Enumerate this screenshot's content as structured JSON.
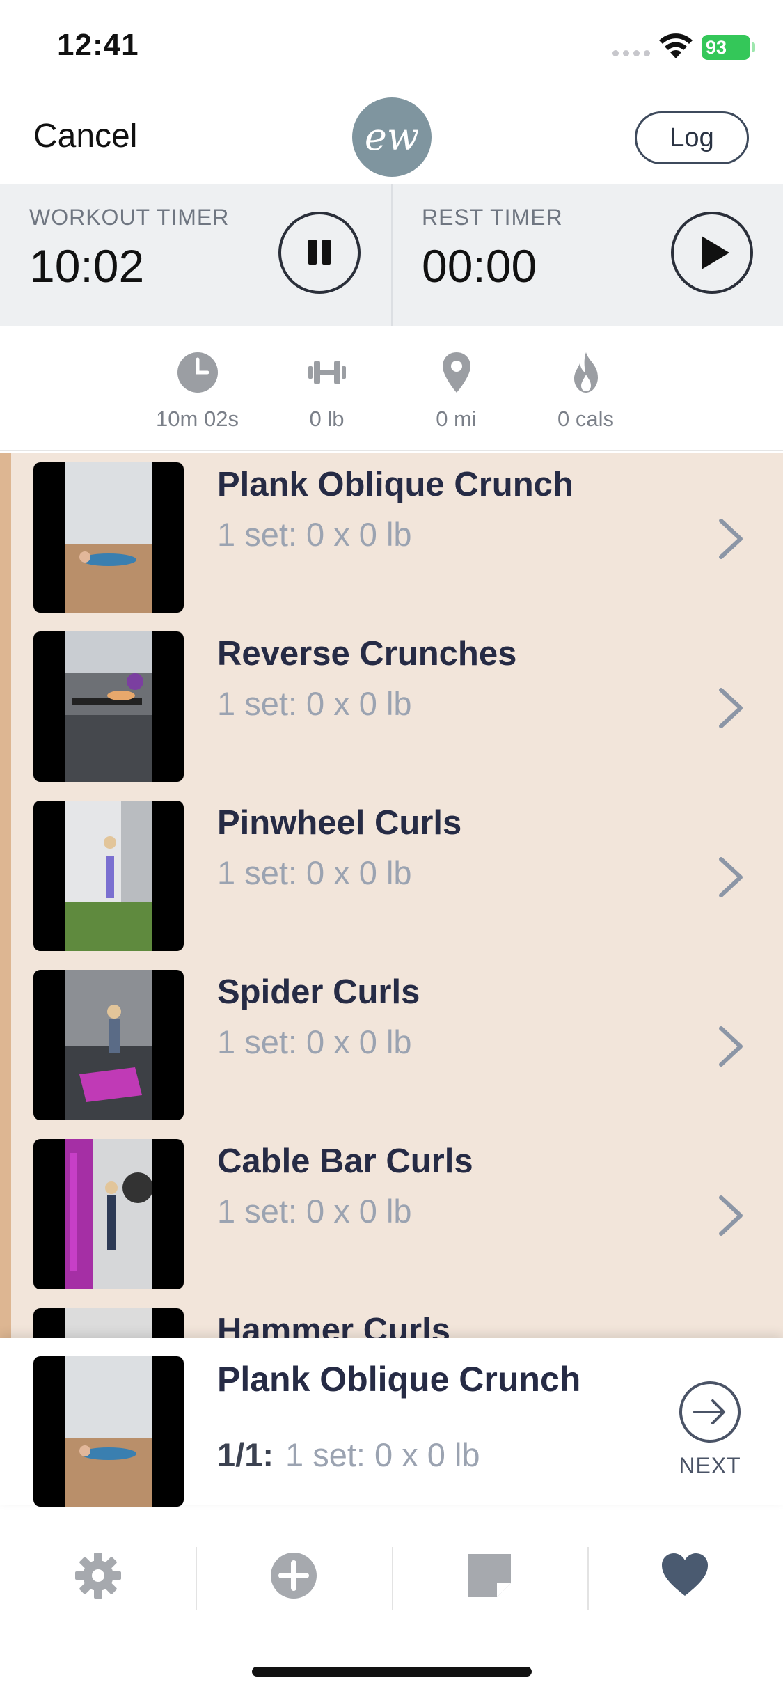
{
  "status_bar": {
    "time": "12:41",
    "battery": "93"
  },
  "header": {
    "cancel_label": "Cancel",
    "logo_text": "ew",
    "log_label": "Log"
  },
  "timers": {
    "workout": {
      "label": "WORKOUT TIMER",
      "value": "10:02",
      "control_icon": "pause-icon"
    },
    "rest": {
      "label": "REST TIMER",
      "value": "00:00",
      "control_icon": "play-icon"
    }
  },
  "stats": [
    {
      "icon": "clock-icon",
      "value": "10m 02s"
    },
    {
      "icon": "dumbbell-icon",
      "value": "0 lb"
    },
    {
      "icon": "location-pin-icon",
      "value": "0 mi"
    },
    {
      "icon": "flame-icon",
      "value": "0 cals"
    }
  ],
  "exercises": [
    {
      "name": "Plank Oblique Crunch",
      "summary": "1 set: 0 x 0 lb"
    },
    {
      "name": "Reverse Crunches",
      "summary": "1 set: 0 x 0 lb"
    },
    {
      "name": "Pinwheel Curls",
      "summary": "1 set: 0 x 0 lb"
    },
    {
      "name": "Spider Curls",
      "summary": "1 set: 0 x 0 lb"
    },
    {
      "name": "Cable Bar Curls",
      "summary": "1 set: 0 x 0 lb"
    },
    {
      "name": "Hammer Curls",
      "summary": ""
    }
  ],
  "now_playing": {
    "name": "Plank Oblique Crunch",
    "count": "1/1:",
    "summary": "1 set: 0 x 0 lb",
    "next_label": "NEXT"
  },
  "tabbar": [
    {
      "icon": "gear-icon"
    },
    {
      "icon": "plus-circle-icon"
    },
    {
      "icon": "note-icon"
    },
    {
      "icon": "heart-icon"
    }
  ],
  "colors": {
    "list_background": "#f2e5da",
    "list_accent": "#ddb692",
    "title_text": "#262b45",
    "subtitle_text": "#9ba3b1",
    "logo_background": "#7f959f",
    "icon_gray": "#a6a9ae",
    "heart_active": "#4a5a70"
  }
}
